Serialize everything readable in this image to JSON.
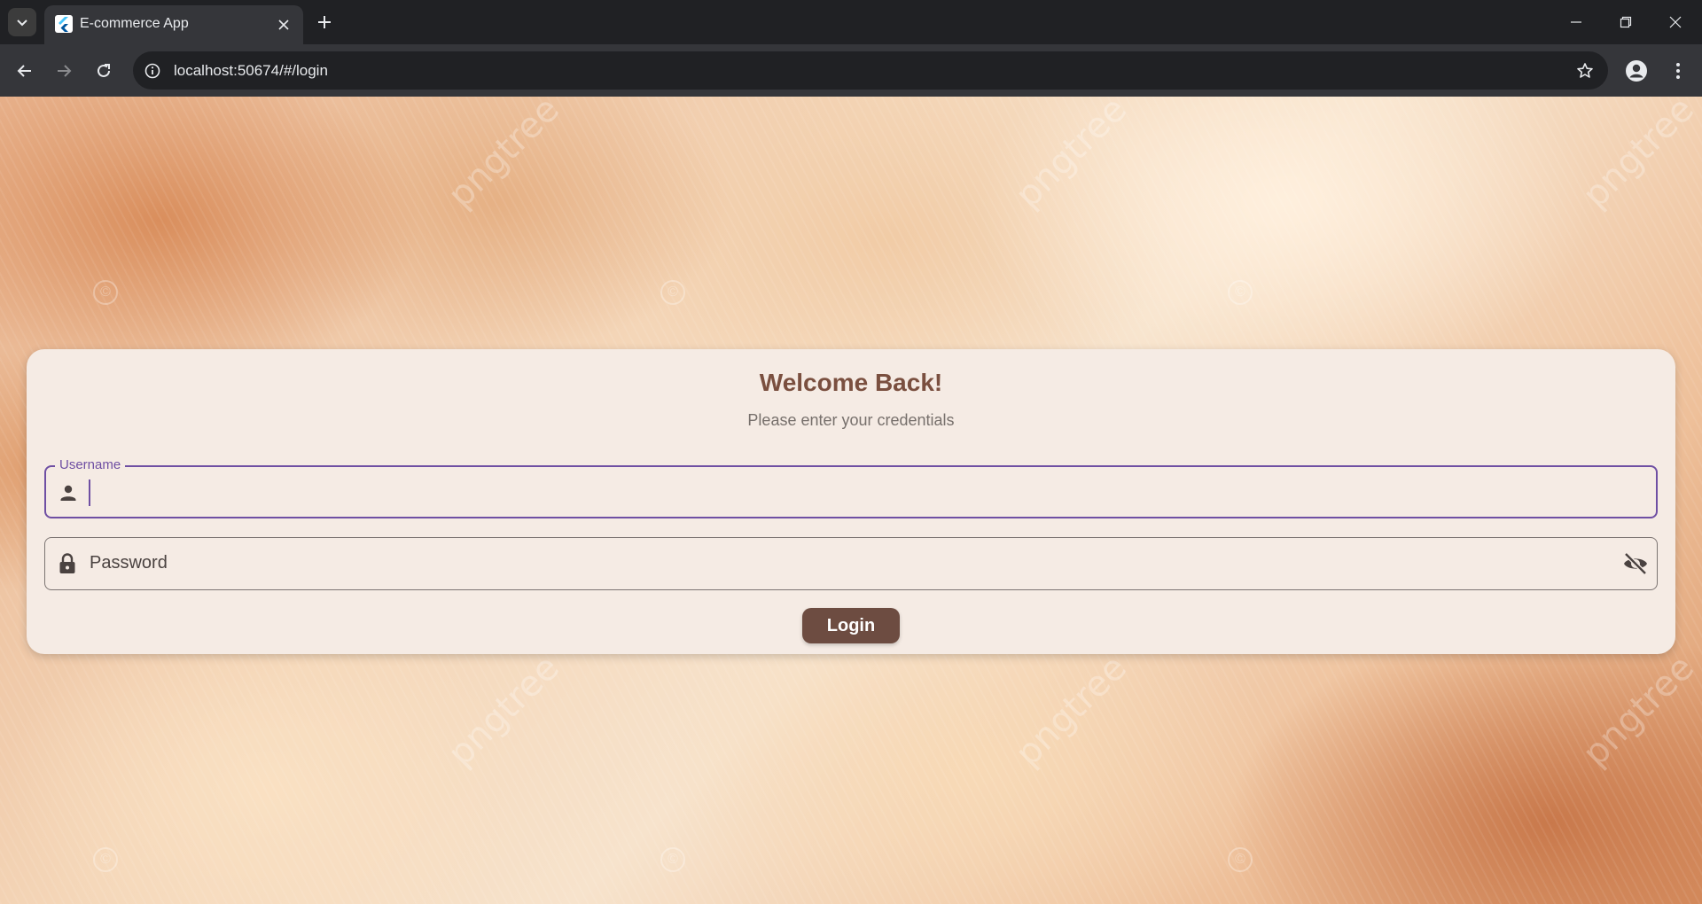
{
  "browser": {
    "tab_title": "E-commerce App",
    "url": "localhost:50674/#/login"
  },
  "watermark": {
    "text": "pngtree",
    "copyright": "©"
  },
  "login_card": {
    "title": "Welcome Back!",
    "subtitle": "Please enter your credentials",
    "username": {
      "label": "Username",
      "value": ""
    },
    "password": {
      "placeholder": "Password",
      "value": ""
    },
    "login_button": "Login"
  },
  "colors": {
    "card_background": "#f5ebe4",
    "title": "#7a4f3f",
    "focus_border": "#6f4fa3",
    "button": "#6d4c41"
  },
  "icons": {
    "username_field": "person-icon",
    "password_field": "lock-icon",
    "password_toggle": "visibility-off-icon"
  }
}
